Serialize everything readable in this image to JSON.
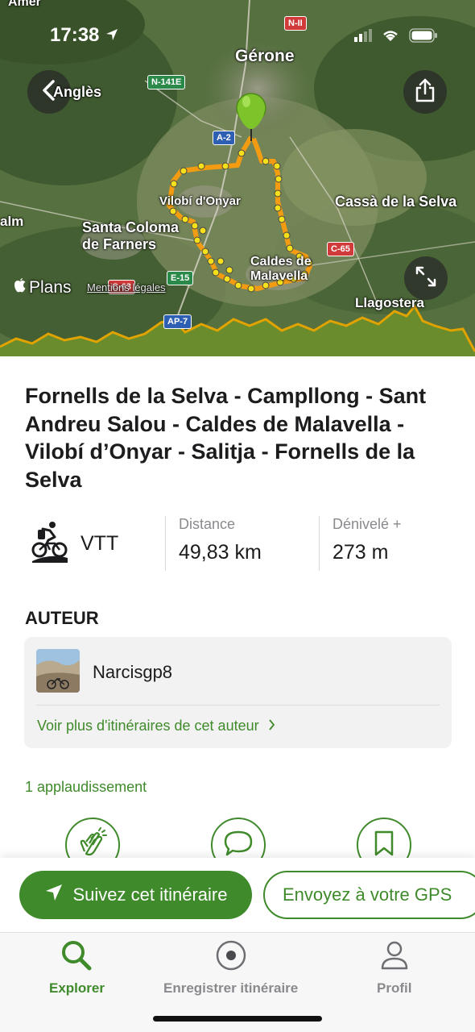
{
  "status_bar": {
    "time": "17:38"
  },
  "map": {
    "back_label": "Anglès",
    "attribution": "Plans",
    "legal_link": "Mentions légales",
    "places": {
      "top_left": "Amer",
      "girona": "Gérone",
      "vilobi": "Vilobí d'Onyar",
      "cassa": "Cassà de la Selva",
      "salm": "alm",
      "santa_coloma_1": "Santa Coloma",
      "santa_coloma_2": "de Farners",
      "caldes_1": "Caldes de",
      "caldes_2": "Malavella",
      "llagostera": "Llagostera"
    },
    "road_signs": {
      "n2": "N-II",
      "n141e": "N-141E",
      "a2": "A-2",
      "c65": "C-65",
      "e15": "E-15",
      "c63": "C-63",
      "ap7": "AP-7"
    },
    "colors": {
      "track": "#f39c12",
      "waypoint": "#f5e01a",
      "elevation": "#d8a000"
    }
  },
  "route": {
    "title": "Fornells de la Selva - Campllong - Sant Andreu Salou - Caldes de Malavella - Vilobí d’Onyar - Salitja - Fornells de la Selva",
    "activity": "VTT",
    "distance_label": "Distance",
    "distance_value": "49,83 km",
    "elevation_label": "Dénivelé +",
    "elevation_value": "273 m"
  },
  "author": {
    "section_title": "AUTEUR",
    "name": "Narcisgp8",
    "more_link": "Voir plus d'itinéraires de cet auteur"
  },
  "social": {
    "applause": "1 applaudissement"
  },
  "cta": {
    "follow": "Suivez cet itinéraire",
    "send_gps": "Envoyez à votre GPS"
  },
  "tabs": [
    {
      "label": "Explorer",
      "icon": "search-icon",
      "active": true
    },
    {
      "label": "Enregistrer itinéraire",
      "icon": "record-icon",
      "active": false
    },
    {
      "label": "Profil",
      "icon": "person-icon",
      "active": false
    }
  ],
  "theme": {
    "accent": "#3f8a2a",
    "text": "#1c1c1e",
    "muted": "#8a8a8e"
  }
}
